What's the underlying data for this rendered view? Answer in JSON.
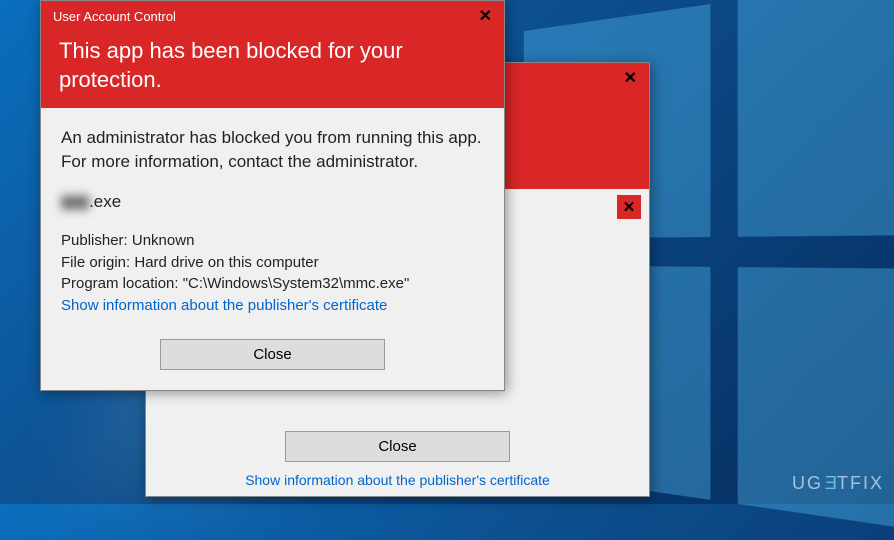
{
  "background": {
    "watermark": "UG⧢TFIX"
  },
  "dialog_back": {
    "titlebar_title": "",
    "close_label": "Close",
    "cert_link": "Show information about the publisher's certificate"
  },
  "dialog_front": {
    "titlebar_title": "User Account Control",
    "heading": "This app has been blocked for your protection.",
    "body": "An administrator has blocked you from running this app. For more information, contact the administrator.",
    "exe_blur": "▮▮▮",
    "exe_suffix": ".exe",
    "details": {
      "publisher_label": "Publisher:",
      "publisher_value": "Unknown",
      "origin_label": "File origin:",
      "origin_value": "Hard drive on this computer",
      "location_label": "Program location:",
      "location_value": "\"C:\\Windows\\System32\\mmc.exe\""
    },
    "cert_link": "Show information about the publisher's certificate",
    "close_label": "Close"
  }
}
